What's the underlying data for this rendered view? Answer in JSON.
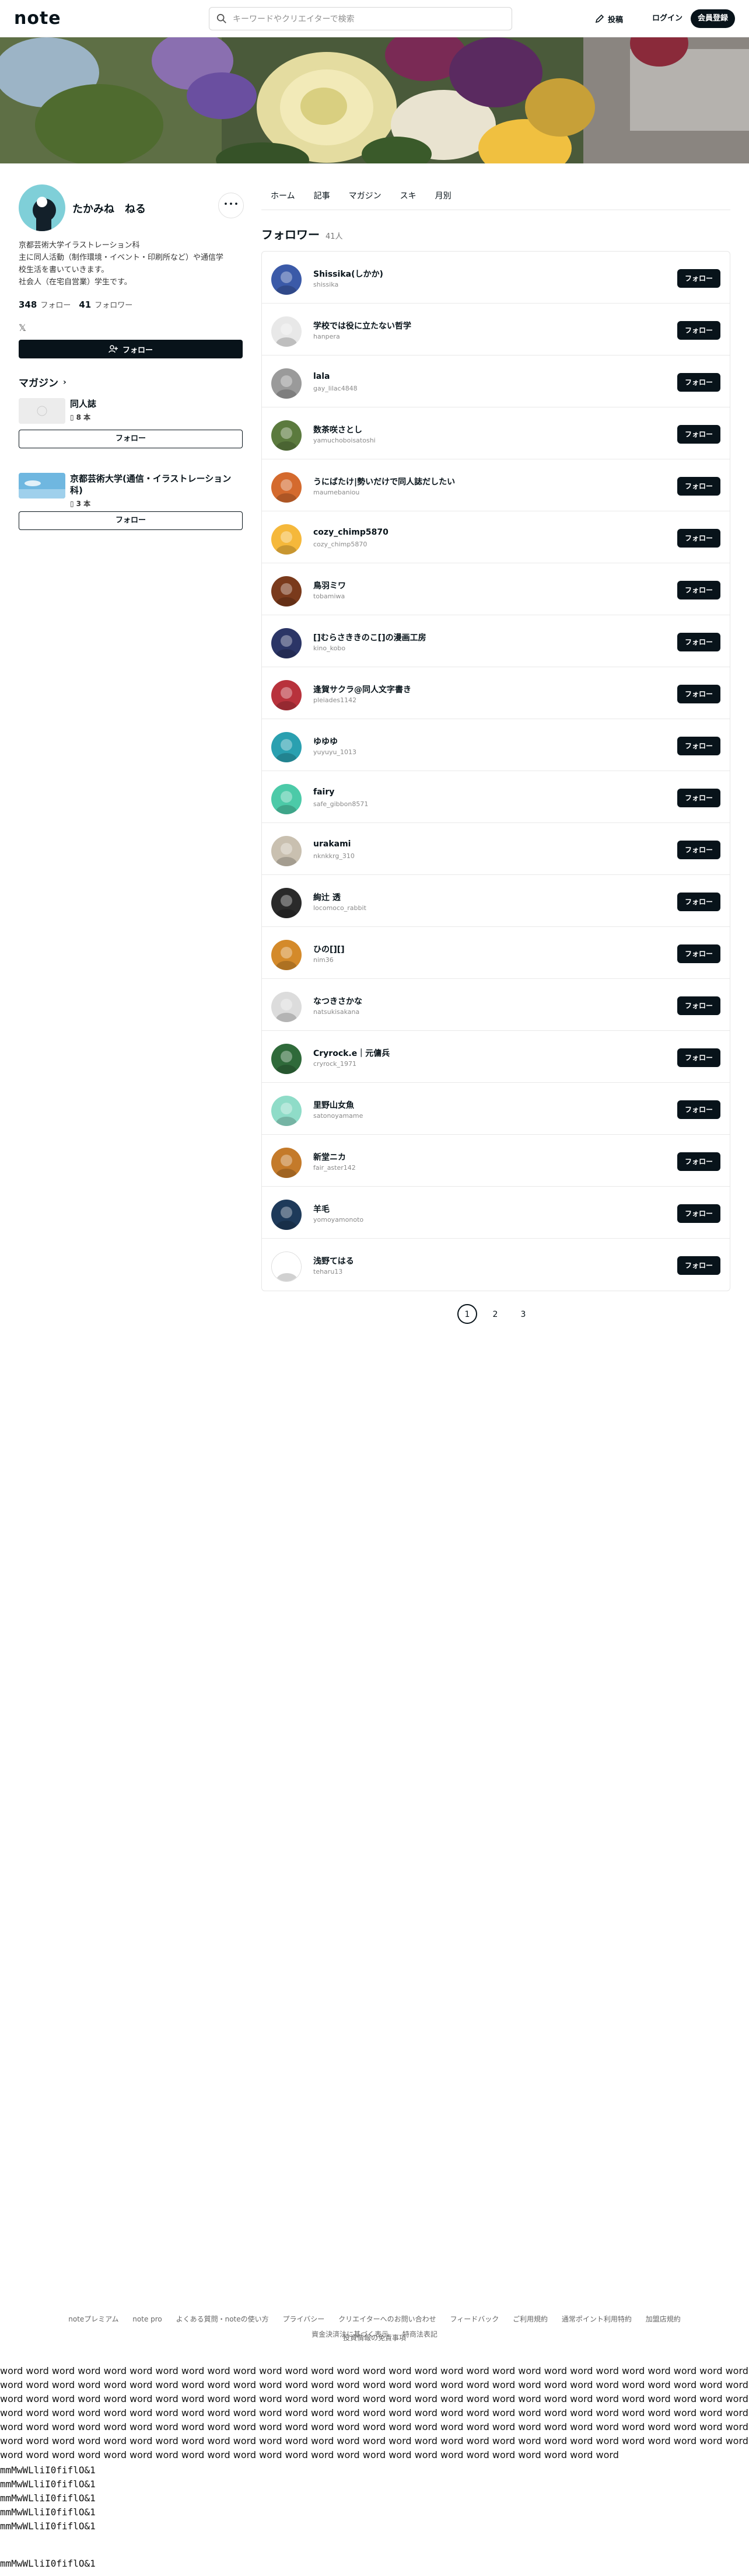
{
  "header": {
    "logo": "note",
    "search_placeholder": "キーワードやクリエイターで検索",
    "post_label": "投稿",
    "login_label": "ログイン",
    "signup_label": "会員登録"
  },
  "profile": {
    "name": "たかみね　ねる",
    "more_label": "･･･",
    "bio": [
      "京都芸術大学イラストレーション科",
      "主に同人活動（制作環境・イベント・印刷所など）や通信学",
      "校生活を書いていきます。",
      "社会人（在宅自営業）学生です。"
    ],
    "following_count": "348",
    "following_label": "フォロー",
    "follower_count": "41",
    "follower_label": "フォロワー",
    "x_icon_glyph": "𝕏",
    "follow_label": "フォロー"
  },
  "magazines": {
    "heading": "マガジン",
    "items": [
      {
        "title": "同人誌",
        "count": "8 本",
        "follow_label": "フォロー"
      },
      {
        "title": "京都芸術大学(通信・イラストレーション科)",
        "count": "3 本",
        "follow_label": "フォロー"
      }
    ]
  },
  "tabs": [
    "ホーム",
    "記事",
    "マガジン",
    "スキ",
    "月別"
  ],
  "followers": {
    "heading": "フォロワー",
    "count": "41人",
    "follow_label": "フォロー",
    "items": [
      {
        "name": "Shissika(しかか)",
        "id": "shissika",
        "color": "#3b5aa8"
      },
      {
        "name": "学校では役に立たない哲学",
        "id": "hanpera",
        "color": "#e8e8e8"
      },
      {
        "name": "lala",
        "id": "gay_lilac4848",
        "color": "#9a9a9a"
      },
      {
        "name": "数茶咲さとし",
        "id": "yamuchoboisatoshi",
        "color": "#5b7a3e"
      },
      {
        "name": "うにばたけ|勢いだけで同人誌だしたい",
        "id": "maumebaniou",
        "color": "#d46a2e"
      },
      {
        "name": "cozy_chimp5870",
        "id": "cozy_chimp5870",
        "color": "#f5b83b"
      },
      {
        "name": "鳥羽ミワ",
        "id": "tobamiwa",
        "color": "#7a3a1c"
      },
      {
        "name": "[]むらさききのこ[]の漫画工房",
        "id": "kino_kobo",
        "color": "#2b3566"
      },
      {
        "name": "逢賀サクラ@同人文字書き",
        "id": "pleiades1142",
        "color": "#b8323c"
      },
      {
        "name": "ゆゆゆ",
        "id": "yuyuyu_1013",
        "color": "#2aa0b0"
      },
      {
        "name": "fairy",
        "id": "safe_gibbon8571",
        "color": "#4ccaa8"
      },
      {
        "name": "urakami",
        "id": "nknkkrg_310",
        "color": "#c9c0b0"
      },
      {
        "name": "絢辻 透",
        "id": "locomoco_rabbit",
        "color": "#2a2a2a"
      },
      {
        "name": "ひの[][]",
        "id": "nim36",
        "color": "#d48a2a"
      },
      {
        "name": "なつきさかな",
        "id": "natsukisakana",
        "color": "#dcdcdc"
      },
      {
        "name": "Cryrock.e｜元傭兵",
        "id": "cryrock_1971",
        "color": "#2f6a3a"
      },
      {
        "name": "里野山女魚",
        "id": "satonoyamame",
        "color": "#8fdcc8"
      },
      {
        "name": "新堂ニカ",
        "id": "fair_aster142",
        "color": "#c47a2a"
      },
      {
        "name": "羊毛",
        "id": "yomoyamonoto",
        "color": "#1e3a5a"
      },
      {
        "name": "浅野てはる",
        "id": "teharu13",
        "color": "#ffffff"
      }
    ]
  },
  "pagination": [
    "1",
    "2",
    "3"
  ],
  "footer": {
    "links": [
      "noteプレミアム",
      "note pro",
      "よくある質問・noteの使い方",
      "プライバシー",
      "クリエイターへのお問い合わせ",
      "フィードバック",
      "ご利用規約",
      "通常ポイント利用特約",
      "加盟店規約",
      "資金決済法に基づく表示",
      "特商法表記"
    ],
    "links2": "投資情報の免責事項"
  },
  "test_text": {
    "words": "word word word word word word word word word word word word word word word word word word word word word word word word word word word word word word word word word word word word word word word word word word word word word word word word word word word word word word word word word word word word word word word word word word word word word word word word word word word word word word word word word word word word word word word word word word word word word word word word word word word word word word word word word word word word word word word word word word word word word word word word word word word word word word word word word word word word word word word word word word word word word word word word word word word word word word word word word word word word word word word word word word word word word word word word word word word word word word word word word word word word word word word word word word word word word word word word word word word word word word",
    "mono": [
      "mmMwWLliI0fiflO&1",
      "mmMwWLliI0fiflO&1",
      "mmMwWLliI0fiflO&1",
      "mmMwWLliI0fiflO&1",
      "mmMwWLliI0fiflO&1"
    ],
    "mono_last": "mmMwWLliI0fiflO&1"
  }
}
